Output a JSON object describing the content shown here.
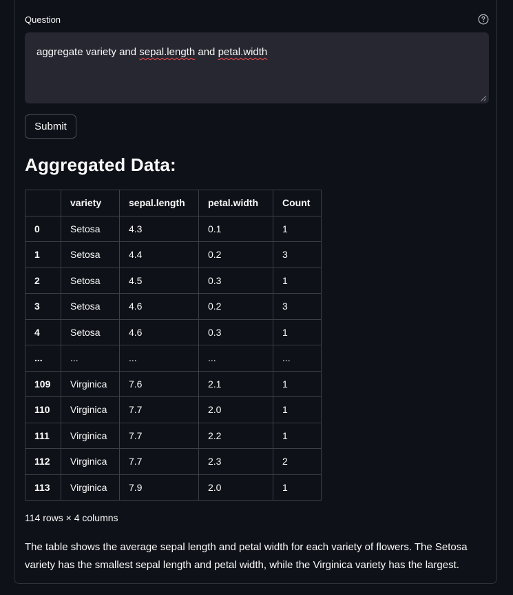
{
  "question": {
    "label": "Question",
    "value_parts": [
      "aggregate variety and ",
      "sepal.length",
      " and ",
      "petal.width"
    ],
    "help_icon": "help-circle-icon"
  },
  "submit": {
    "label": "Submit"
  },
  "result": {
    "heading": "Aggregated Data:",
    "columns": [
      "",
      "variety",
      "sepal.length",
      "petal.width",
      "Count"
    ],
    "rows": [
      [
        "0",
        "Setosa",
        "4.3",
        "0.1",
        "1"
      ],
      [
        "1",
        "Setosa",
        "4.4",
        "0.2",
        "3"
      ],
      [
        "2",
        "Setosa",
        "4.5",
        "0.3",
        "1"
      ],
      [
        "3",
        "Setosa",
        "4.6",
        "0.2",
        "3"
      ],
      [
        "4",
        "Setosa",
        "4.6",
        "0.3",
        "1"
      ],
      [
        "...",
        "...",
        "...",
        "...",
        "..."
      ],
      [
        "109",
        "Virginica",
        "7.6",
        "2.1",
        "1"
      ],
      [
        "110",
        "Virginica",
        "7.7",
        "2.0",
        "1"
      ],
      [
        "111",
        "Virginica",
        "7.7",
        "2.2",
        "1"
      ],
      [
        "112",
        "Virginica",
        "7.7",
        "2.3",
        "2"
      ],
      [
        "113",
        "Virginica",
        "7.9",
        "2.0",
        "1"
      ]
    ],
    "shape_label": "114 rows × 4 columns",
    "summary": "The table shows the average sepal length and petal width for each variety of flowers. The Setosa variety has the smallest sepal length and petal width, while the Virginica variety has the largest."
  },
  "colors": {
    "background": "#0e1117",
    "input_background": "#262730",
    "border": "#3d3f49",
    "spellcheck": "#ff4b4b"
  }
}
